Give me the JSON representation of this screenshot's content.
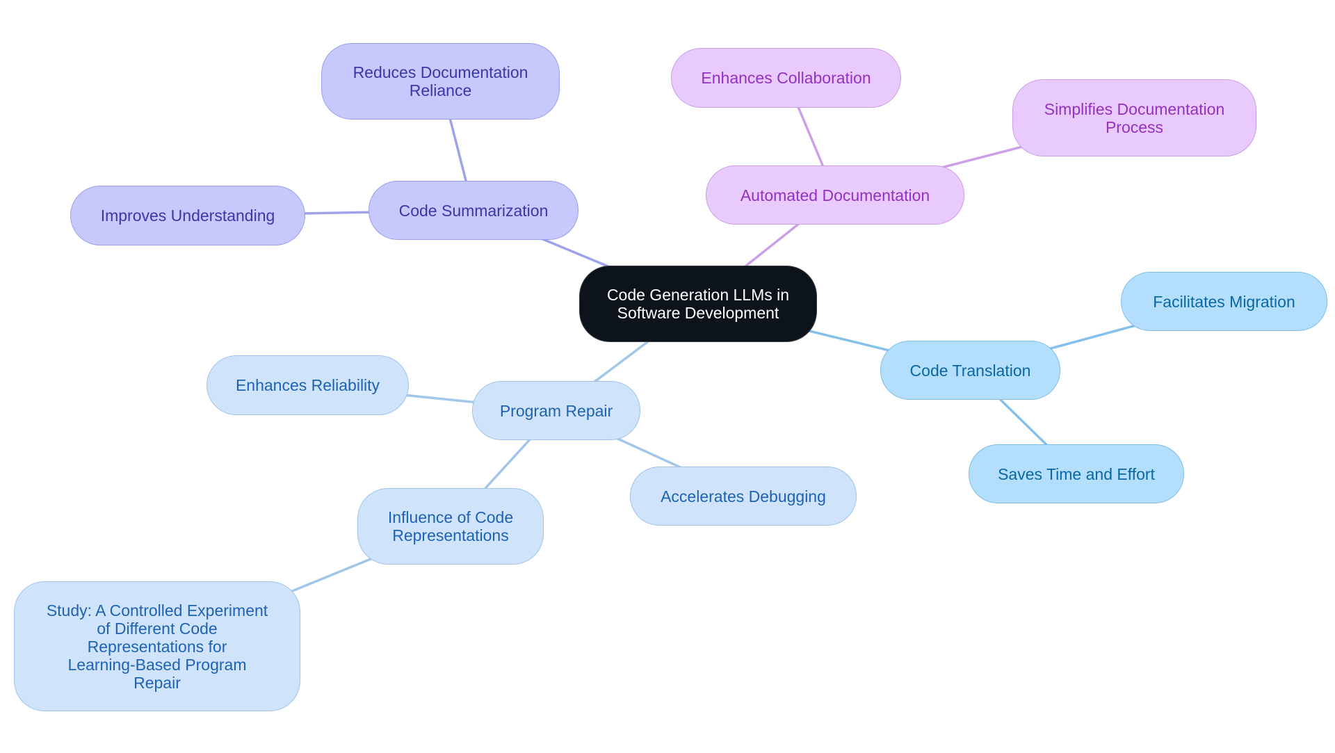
{
  "diagram": {
    "type": "mindmap",
    "root": {
      "id": "root",
      "label": "Code Generation LLMs in\nSoftware Development"
    },
    "groups": {
      "indigo": {
        "fill": "#c7c9fc",
        "stroke": "#9a9ee8",
        "text": "#3a37a8",
        "edge": "#9ea2ea"
      },
      "violet": {
        "fill": "#e9cafd",
        "stroke": "#c99ce9",
        "text": "#9430c2",
        "edge": "#cc9fe9"
      },
      "sky": {
        "fill": "#b3dffc",
        "stroke": "#7fbde9",
        "text": "#0a67a3",
        "edge": "#84c1ea"
      },
      "blue": {
        "fill": "#cfe4fb",
        "stroke": "#9fc3ea",
        "text": "#1f62b2",
        "edge": "#a2c5ea"
      }
    },
    "nodes": [
      {
        "id": "code-summarization",
        "label": "Code Summarization",
        "parent": "root",
        "group": "indigo"
      },
      {
        "id": "reduces-documentation-reliance",
        "label": "Reduces Documentation\nReliance",
        "parent": "code-summarization",
        "group": "indigo"
      },
      {
        "id": "improves-understanding",
        "label": "Improves Understanding",
        "parent": "code-summarization",
        "group": "indigo"
      },
      {
        "id": "automated-documentation",
        "label": "Automated Documentation",
        "parent": "root",
        "group": "violet"
      },
      {
        "id": "enhances-collaboration",
        "label": "Enhances Collaboration",
        "parent": "automated-documentation",
        "group": "violet"
      },
      {
        "id": "simplifies-documentation-process",
        "label": "Simplifies Documentation\nProcess",
        "parent": "automated-documentation",
        "group": "violet"
      },
      {
        "id": "code-translation",
        "label": "Code Translation",
        "parent": "root",
        "group": "sky"
      },
      {
        "id": "facilitates-migration",
        "label": "Facilitates Migration",
        "parent": "code-translation",
        "group": "sky"
      },
      {
        "id": "saves-time-and-effort",
        "label": "Saves Time and Effort",
        "parent": "code-translation",
        "group": "sky"
      },
      {
        "id": "program-repair",
        "label": "Program Repair",
        "parent": "root",
        "group": "blue"
      },
      {
        "id": "enhances-reliability",
        "label": "Enhances Reliability",
        "parent": "program-repair",
        "group": "blue"
      },
      {
        "id": "accelerates-debugging",
        "label": "Accelerates Debugging",
        "parent": "program-repair",
        "group": "blue"
      },
      {
        "id": "influence-of-code-representations",
        "label": "Influence of Code\nRepresentations",
        "parent": "program-repair",
        "group": "blue"
      },
      {
        "id": "study-controlled-experiment",
        "label": "Study: A Controlled Experiment\nof Different Code\nRepresentations for\nLearning-Based Program\nRepair",
        "parent": "influence-of-code-representations",
        "group": "blue"
      }
    ]
  }
}
